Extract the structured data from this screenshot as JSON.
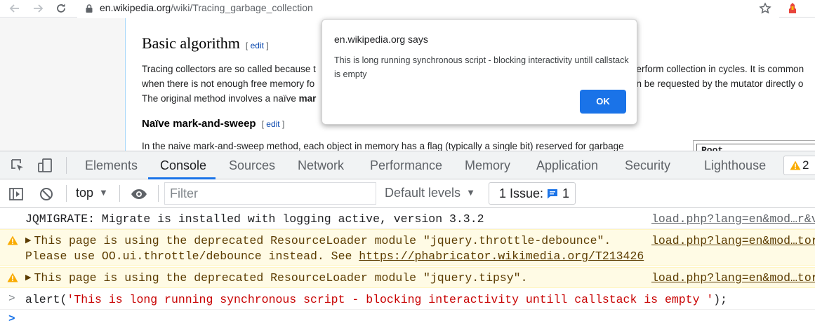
{
  "browser": {
    "url_domain": "en.wikipedia.org",
    "url_path": "/wiki/Tracing_garbage_collection"
  },
  "wiki": {
    "heading": "Basic algorithm",
    "edit_open": "[",
    "edit_label": "edit",
    "edit_close": "]",
    "para_line1_left": "Tracing collectors are so called because t",
    "para_line1_right": "perform collection in cycles. It is common",
    "para_line2_left": "when there is not enough free memory fo",
    "para_line2_right": "en be requested by the mutator directly o",
    "para_line3_left": "The original method involves a naïve ",
    "para_line3_bold": "mar",
    "subheading": "Naïve mark-and-sweep",
    "sub_edit_label": "edit",
    "para4": "In the naive mark-and-sweep method, each object in memory has a flag (typically a single bit) reserved for garbage",
    "diagram_label": "Root"
  },
  "dialog": {
    "title": "en.wikipedia.org says",
    "message": "This is long running synchronous script - blocking interactivity untill callstack is empty",
    "ok_label": "OK"
  },
  "devtools": {
    "tabs": [
      {
        "label": "Elements"
      },
      {
        "label": "Console"
      },
      {
        "label": "Sources"
      },
      {
        "label": "Network"
      },
      {
        "label": "Performance"
      },
      {
        "label": "Memory"
      },
      {
        "label": "Application"
      },
      {
        "label": "Security"
      },
      {
        "label": "Lighthouse"
      }
    ],
    "active_tab": "Console",
    "warning_count": "2",
    "toolbar": {
      "context": "top",
      "filter_placeholder": "Filter",
      "levels": "Default levels",
      "issues_label": "1 Issue:",
      "issues_count": "1"
    },
    "console": {
      "line1": "JQMIGRATE: Migrate is installed with logging active, version 3.3.2",
      "line1_src": "load.php?lang=en&mod…r&v",
      "warn1_line1": "This page is using the deprecated ResourceLoader module \"jquery.throttle-debounce\".",
      "warn1_line2_text": "Please use OO.ui.throttle/debounce instead. See ",
      "warn1_line2_link": "https://phabricator.wikimedia.org/T213426",
      "warn1_src": "load.php?lang=en&mod…tor",
      "warn2": "This page is using the deprecated ResourceLoader module \"jquery.tipsy\".",
      "warn2_src": "load.php?lang=en&mod…tor",
      "input_prefix": "alert(",
      "input_string": "'This is long running synchronous script - blocking interactivity untill callstack is empty '",
      "input_suffix": ");"
    }
  },
  "colors": {
    "accent": "#1a73e8",
    "warning_bg": "#fffbe5",
    "warning_icon": "#f9ab00",
    "string": "#c80000"
  }
}
